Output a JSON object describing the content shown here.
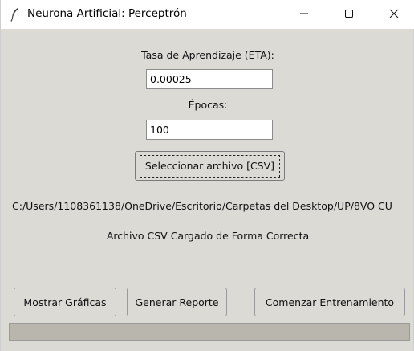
{
  "window": {
    "title": "Neurona Artificial: Perceptrón"
  },
  "form": {
    "eta_label": "Tasa de Aprendizaje (ETA):",
    "eta_value": "0.00025",
    "epochs_label": "Épocas:",
    "epochs_value": "100",
    "select_file_button": "Seleccionar archivo [CSV]"
  },
  "file_path": "C:/Users/1108361138/OneDrive/Escritorio/Carpetas del Desktop/UP/8VO CU",
  "status_message": "Archivo CSV Cargado de Forma Correcta",
  "actions": {
    "show_charts": "Mostrar Gráficas",
    "generate_report": "Generar Reporte",
    "start_training": "Comenzar Entrenamiento"
  },
  "progress": {
    "fraction": 0.0
  },
  "icons": {
    "app": "feather-icon",
    "minimize": "minimize-icon",
    "maximize": "maximize-icon",
    "close": "close-icon"
  }
}
